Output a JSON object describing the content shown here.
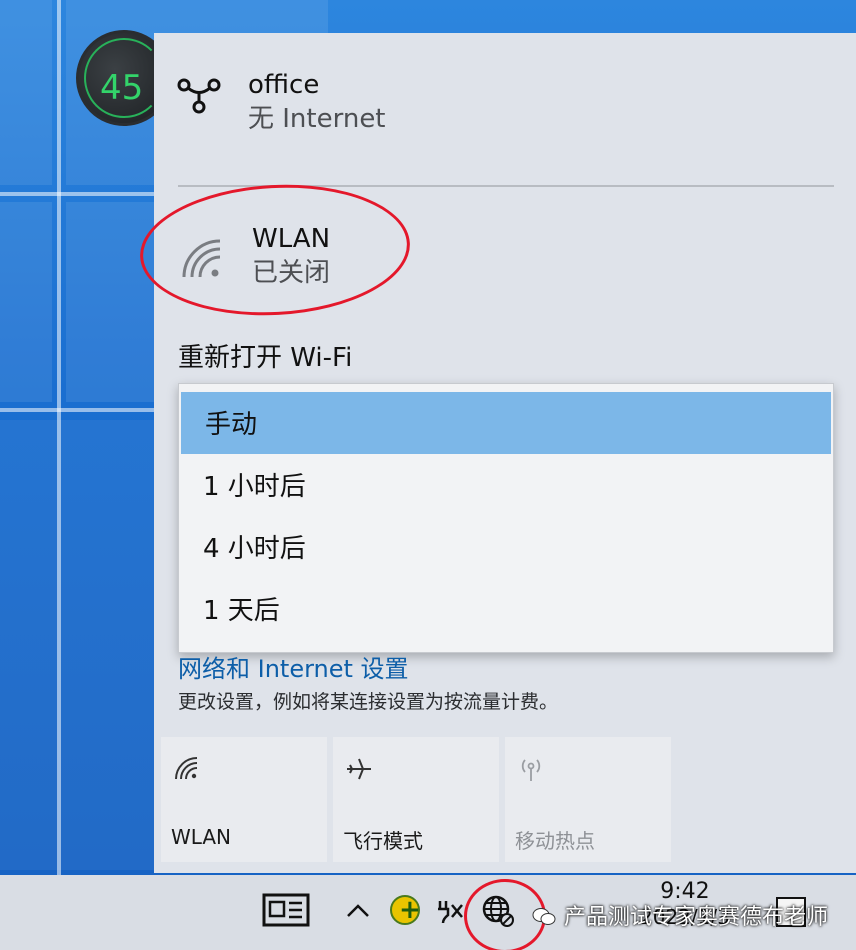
{
  "desktop": {
    "gadget_value": "45"
  },
  "flyout": {
    "ethernet": {
      "name": "office",
      "status": "无 Internet",
      "icon": "ethernet-icon"
    },
    "wlan": {
      "name": "WLAN",
      "status": "已关闭",
      "icon": "wifi-icon"
    },
    "reopen_label": "重新打开 Wi-Fi",
    "dropdown_options": [
      "手动",
      "1 小时后",
      "4 小时后",
      "1 天后"
    ],
    "selected_option": "手动",
    "settings_link": "网络和 Internet 设置",
    "settings_desc": "更改设置，例如将某连接设置为按流量计费。",
    "tiles": [
      {
        "label": "WLAN",
        "icon": "wifi-icon",
        "enabled": true
      },
      {
        "label": "飞行模式",
        "icon": "airplane-icon",
        "enabled": true
      },
      {
        "label": "移动热点",
        "icon": "hotspot-icon",
        "enabled": false
      }
    ]
  },
  "taskbar": {
    "time": "9:42",
    "date": "2022/1/3",
    "watermark": "产品测试专家奥赛德布老师"
  },
  "colors": {
    "flyout_bg": "#dfe3ea",
    "selected_option": "#7cb7e8",
    "link": "#0d5ea8",
    "annotation_red": "#e4182b"
  }
}
